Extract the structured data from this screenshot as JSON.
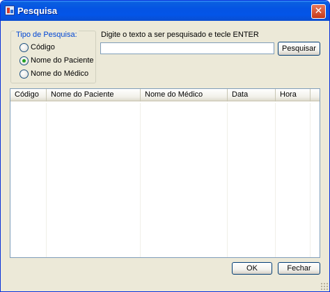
{
  "window": {
    "title": "Pesquisa",
    "close_glyph": "✕",
    "icon": "app-window-icon"
  },
  "search_type": {
    "legend": "Tipo de Pesquisa:",
    "options": [
      {
        "label": "Código",
        "selected": false
      },
      {
        "label": "Nome do Paciente",
        "selected": true
      },
      {
        "label": "Nome do Médico",
        "selected": false
      }
    ]
  },
  "search": {
    "instruction": "Digite o texto a ser pesquisado e tecle ENTER",
    "value": "",
    "button_label": "Pesquisar"
  },
  "results_grid": {
    "columns": [
      "Código",
      "Nome do Paciente",
      "Nome do Médico",
      "Data",
      "Hora"
    ],
    "rows": []
  },
  "footer": {
    "ok_label": "OK",
    "close_label": "Fechar"
  },
  "colors": {
    "titlebar": "#0554e3",
    "dialog_background": "#ece9d8",
    "legend_text": "#0046d5",
    "radio_selected_dot": "#21a121"
  }
}
